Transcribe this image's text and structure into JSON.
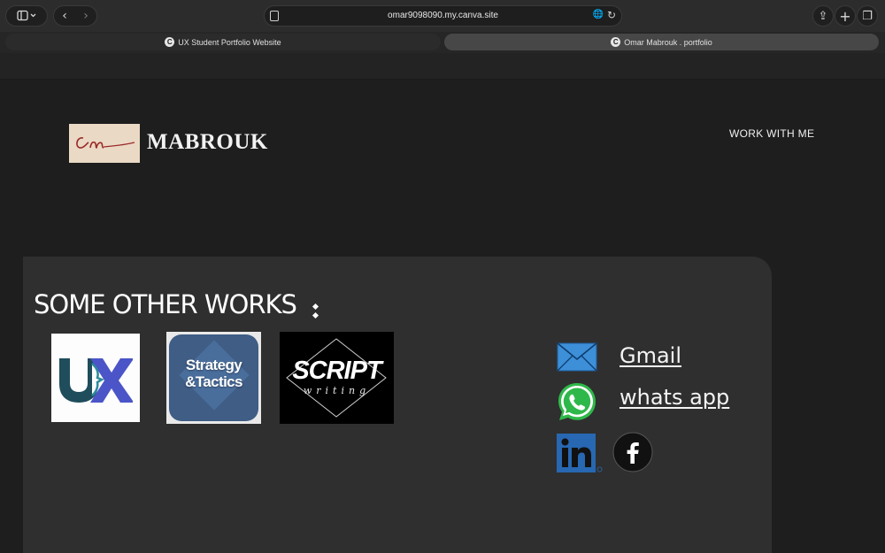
{
  "browser": {
    "url": "omar9098090.my.canva.site",
    "tabs": [
      {
        "label": "UX Student Portfolio Website",
        "active": false,
        "favicon": "C"
      },
      {
        "label": "Omar Mabrouk . portfolio",
        "active": true,
        "favicon": "C"
      }
    ]
  },
  "header": {
    "logo_script": "Om",
    "brand": "MABROUK",
    "nav_link": "WORK WITH ME"
  },
  "main": {
    "section_title": "SOME OTHER WORKS",
    "works": [
      {
        "name": "UX",
        "text": "U X"
      },
      {
        "name": "Strategy & Tactics",
        "line1": "Strategy",
        "line2": "&Tactics"
      },
      {
        "name": "Script Writing",
        "line1": "SCRIPT",
        "line2": "writing"
      }
    ],
    "contacts": {
      "gmail_label": "Gmail",
      "whatsapp_label": "whats app"
    }
  },
  "colors": {
    "page_bg": "#1e1e1e",
    "card_bg": "#2f2f2f",
    "mail_blue": "#3d8fd8",
    "whatsapp_green": "#2fb84a",
    "linkedin_blue": "#2867b2"
  }
}
